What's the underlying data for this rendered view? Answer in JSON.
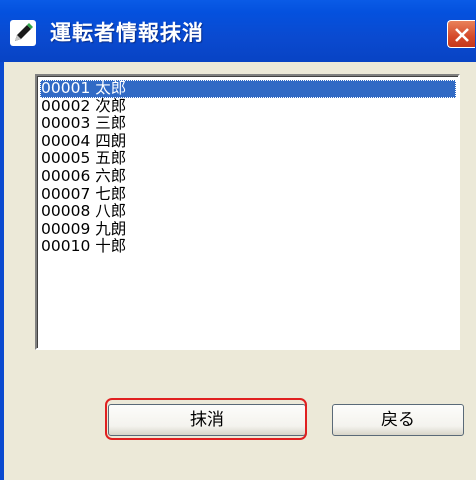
{
  "window": {
    "title": "運転者情報抹消",
    "icon": "pen-icon"
  },
  "colors": {
    "title_bar": "#0a4ad0",
    "selection": "#316ac5",
    "highlight": "#e02020",
    "close": "#d54a2a"
  },
  "drivers": {
    "selected_index": 0,
    "items": [
      "00001 太郎",
      "00002 次郎",
      "00003 三郎",
      "00004 四朗",
      "00005 五郎",
      "00006 六郎",
      "00007 七郎",
      "00008 八郎",
      "00009 九朗",
      "00010 十郎"
    ]
  },
  "buttons": {
    "erase_label": "抹消",
    "back_label": "戻る"
  }
}
